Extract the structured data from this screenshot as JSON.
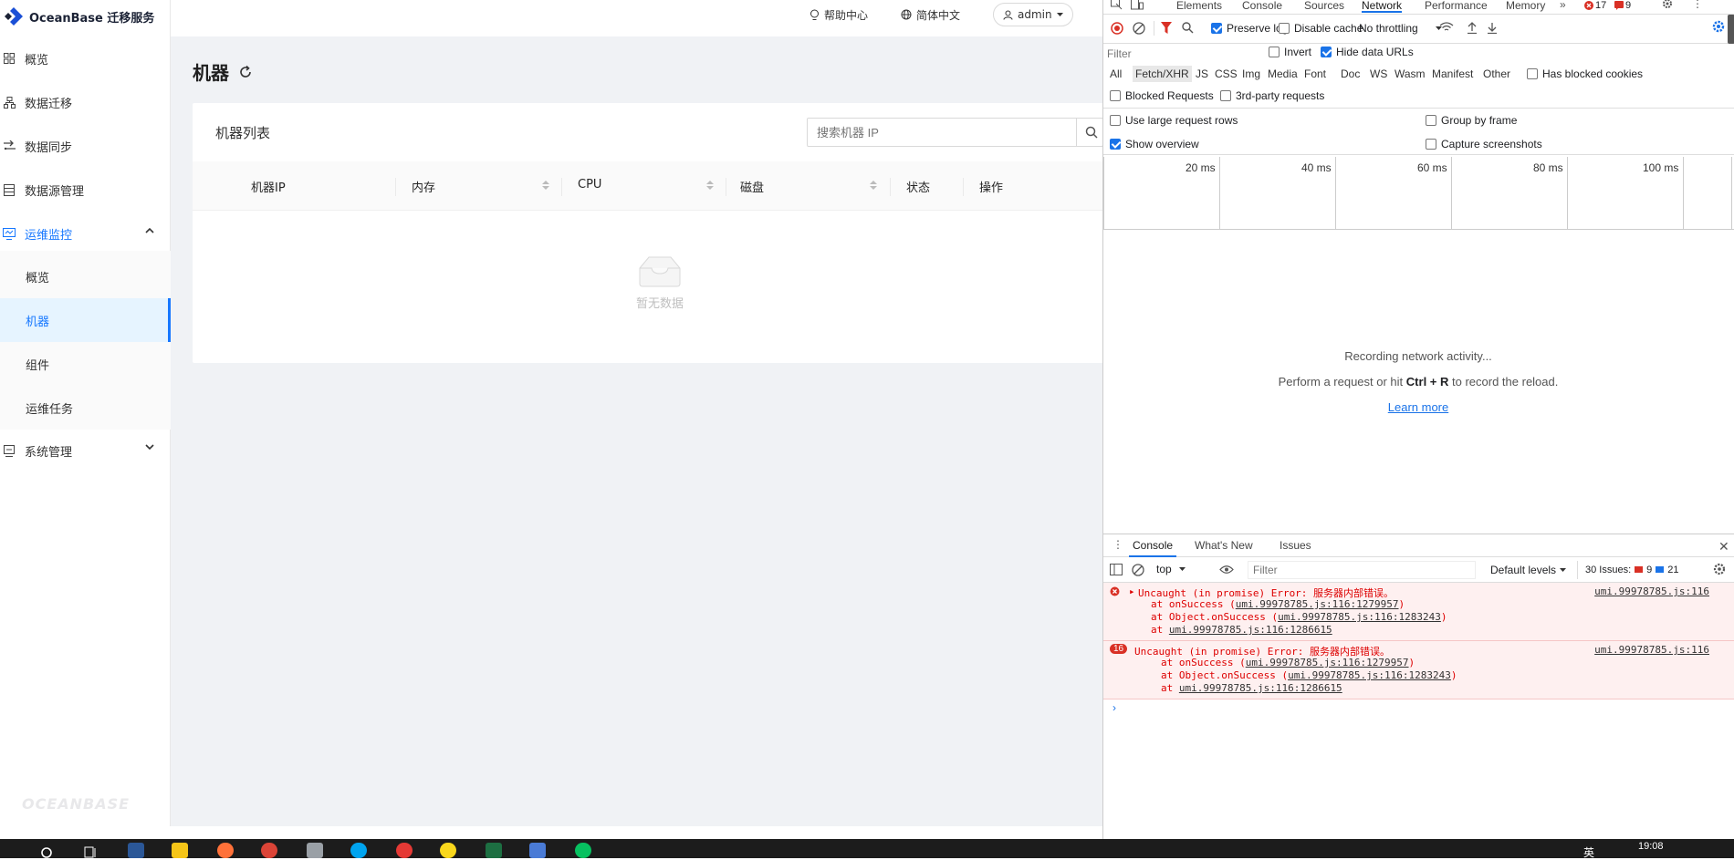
{
  "app": {
    "logo_text": "OceanBase 迁移服务",
    "footer_logo": "OCEANBASE",
    "sidebar": {
      "items": [
        {
          "label": "概览"
        },
        {
          "label": "数据迁移"
        },
        {
          "label": "数据同步"
        },
        {
          "label": "数据源管理"
        },
        {
          "label": "运维监控"
        },
        {
          "label": "系统管理"
        }
      ],
      "sub_items": [
        {
          "label": "概览"
        },
        {
          "label": "机器"
        },
        {
          "label": "组件"
        },
        {
          "label": "运维任务"
        }
      ]
    },
    "header": {
      "help": "帮助中心",
      "language": "简体中文",
      "user": "admin"
    },
    "page_title": "机器",
    "card_title": "机器列表",
    "search_placeholder": "搜索机器 IP",
    "table": {
      "columns": [
        "机器IP",
        "内存",
        "CPU",
        "磁盘",
        "状态",
        "操作"
      ],
      "empty_text": "暂无数据"
    }
  },
  "devtools": {
    "tabs": [
      "Elements",
      "Console",
      "Sources",
      "Network",
      "Performance",
      "Memory"
    ],
    "active_tab": "Network",
    "error_count": "17",
    "warning_count": "9",
    "toolbar": {
      "preserve_log": "Preserve log",
      "disable_cache": "Disable cache",
      "throttling": "No throttling"
    },
    "filter_placeholder": "Filter",
    "invert": "Invert",
    "hide_data_urls": "Hide data URLs",
    "types": [
      "All",
      "Fetch/XHR",
      "JS",
      "CSS",
      "Img",
      "Media",
      "Font",
      "Doc",
      "WS",
      "Wasm",
      "Manifest",
      "Other"
    ],
    "has_blocked_cookies": "Has blocked cookies",
    "blocked_requests": "Blocked Requests",
    "third_party": "3rd-party requests",
    "large_rows": "Use large request rows",
    "group_by_frame": "Group by frame",
    "show_overview": "Show overview",
    "capture_screenshots": "Capture screenshots",
    "timeline_labels": [
      "20 ms",
      "40 ms",
      "60 ms",
      "80 ms",
      "100 ms"
    ],
    "recording_msg": "Recording network activity...",
    "perform_msg_pre": "Perform a request or hit",
    "perform_key": "Ctrl + R",
    "perform_msg_post": "to record the reload.",
    "learn_more": "Learn more",
    "drawer": {
      "tabs": [
        "Console",
        "What's New",
        "Issues"
      ],
      "context": "top",
      "filter_placeholder": "Filter",
      "levels": "Default levels",
      "issues_label": "30 Issues:",
      "issues_err": "9",
      "issues_info": "21",
      "errors": [
        {
          "badge": "",
          "title": "Uncaught (in promise) Error: 服务器内部错误。",
          "lines": [
            {
              "pre": "at onSuccess (",
              "link": "umi.99978785.js:116:1279957",
              "post": ")"
            },
            {
              "pre": "at Object.onSuccess (",
              "link": "umi.99978785.js:116:1283243",
              "post": ")"
            },
            {
              "pre": "at ",
              "link": "umi.99978785.js:116:1286615",
              "post": ""
            }
          ],
          "source": "umi.99978785.js:116"
        },
        {
          "badge": "16",
          "title": "Uncaught (in promise) Error: 服务器内部错误。",
          "lines": [
            {
              "pre": "at onSuccess (",
              "link": "umi.99978785.js:116:1279957",
              "post": ")"
            },
            {
              "pre": "at Object.onSuccess (",
              "link": "umi.99978785.js:116:1283243",
              "post": ")"
            },
            {
              "pre": "at ",
              "link": "umi.99978785.js:116:1286615",
              "post": ""
            }
          ],
          "source": "umi.99978785.js:116"
        }
      ]
    }
  },
  "taskbar": {
    "time": "19:08",
    "lang": "英"
  }
}
